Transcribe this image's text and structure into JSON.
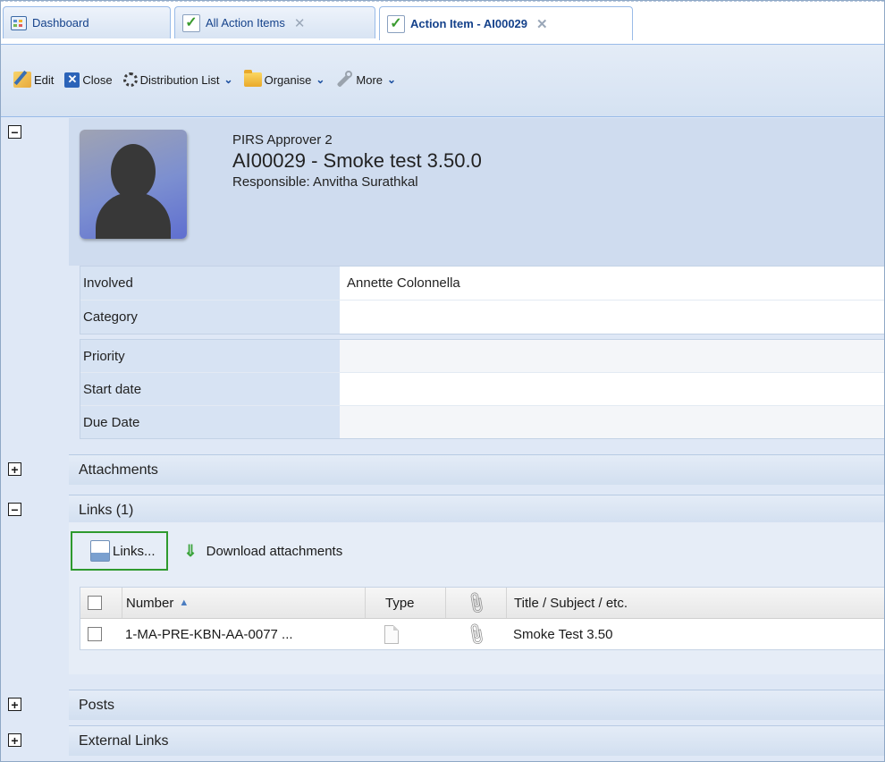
{
  "tabs": [
    {
      "label": "Dashboard",
      "icon": "dashboard-icon",
      "closable": false
    },
    {
      "label": "All Action Items",
      "icon": "checkmark-icon",
      "closable": true
    },
    {
      "label": "Action Item - AI00029",
      "icon": "checkmark-icon",
      "closable": true,
      "active": true
    }
  ],
  "toolbar": {
    "edit": "Edit",
    "close": "Close",
    "distribution_list": "Distribution List",
    "organise": "Organise",
    "more": "More"
  },
  "header": {
    "approver": "PIRS Approver 2",
    "title": "AI00029 - Smoke test 3.50.0",
    "responsible": "Responsible: Anvitha Surathkal"
  },
  "fields_group1": [
    {
      "label": "Involved",
      "value": "Annette Colonnella"
    },
    {
      "label": "Category",
      "value": ""
    }
  ],
  "fields_group2": [
    {
      "label": "Priority",
      "value": ""
    },
    {
      "label": "Start date",
      "value": ""
    },
    {
      "label": "Due Date",
      "value": ""
    }
  ],
  "sections": {
    "attachments": "Attachments",
    "links": "Links (1)",
    "posts": "Posts",
    "external_links": "External Links"
  },
  "links_toolbar": {
    "links_button": "Links...",
    "download": "Download attachments"
  },
  "links_grid": {
    "columns": [
      "Number",
      "Type",
      "Title / Subject / etc."
    ],
    "rows": [
      {
        "number": "1-MA-PRE-KBN-AA-0077 ...",
        "title": "Smoke Test 3.50"
      }
    ]
  },
  "colors": {
    "accent": "#15428b",
    "panel": "#dfe8f6",
    "highlight_border": "#2e9a2e"
  }
}
